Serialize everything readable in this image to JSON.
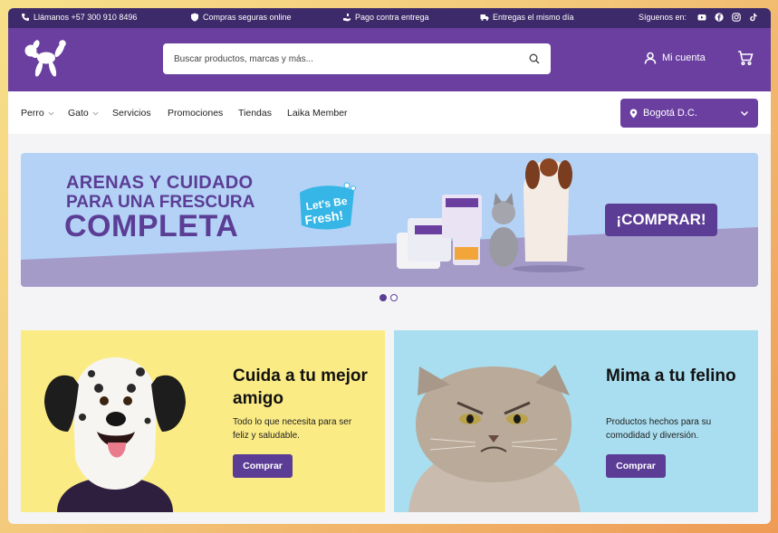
{
  "topbar": {
    "phone": "Llámanos +57 300 910 8496",
    "secure": "Compras seguras online",
    "cod": "Pago contra entrega",
    "delivery": "Entregas el mismo día",
    "follow": "Síguenos en:",
    "social_icons": [
      "youtube-icon",
      "facebook-icon",
      "instagram-icon",
      "tiktok-icon"
    ]
  },
  "header": {
    "search_placeholder": "Buscar productos, marcas y más...",
    "account_label": "Mi cuenta"
  },
  "nav": {
    "items": [
      "Perro",
      "Gato",
      "Servicios",
      "Promociones",
      "Tiendas",
      "Laika Member"
    ],
    "city": "Bogotá D.C."
  },
  "banner": {
    "line1": "ARENAS Y CUIDADO",
    "line2": "PARA UNA FRESCURA",
    "line3": "COMPLETA",
    "brand_text": "Let's Be Fresh!",
    "cta": "¡COMPRAR!",
    "slides": 2,
    "active_slide": 1
  },
  "cards": [
    {
      "title": "Cuida a tu mejor amigo",
      "desc": "Todo lo que necesita para ser feliz y saludable.",
      "button": "Comprar"
    },
    {
      "title": "Mima a tu felino",
      "desc": "Productos hechos para su comodidad y diversión.",
      "button": "Comprar"
    }
  ],
  "colors": {
    "topbar": "#3d2a6a",
    "brand_purple": "#6a3fa0",
    "dog_card": "#fbeb85",
    "cat_card": "#a9def0",
    "banner_sky": "#b3d2f6"
  }
}
